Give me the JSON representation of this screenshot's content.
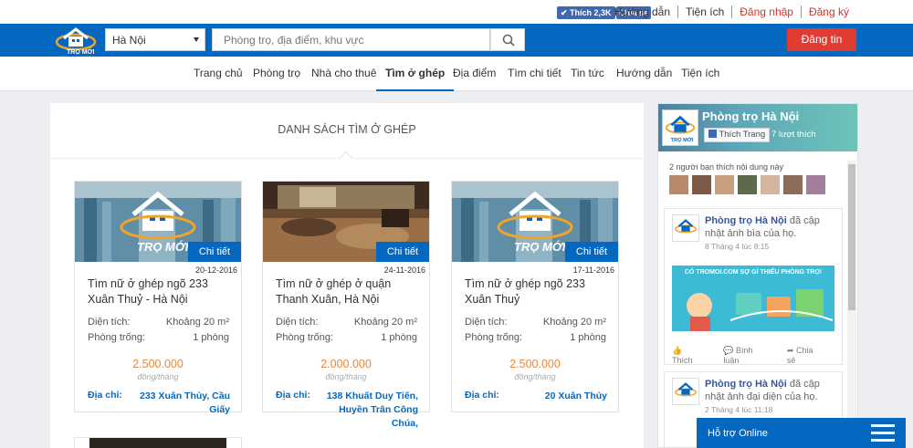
{
  "topbar": {
    "fb_like": "Thích 2,3K",
    "fb_share": "Chia sẻ",
    "links": [
      "Hướng dẫn",
      "Tiện ích",
      "Đăng nhập",
      "Đăng ký"
    ]
  },
  "header": {
    "logo_text": "TRỌ MỚI",
    "city": "Hà Nội",
    "search_placeholder": "Phòng trọ, địa điểm, khu vực",
    "post_button": "Đăng tin"
  },
  "nav": [
    "Trang chủ",
    "Phòng trọ",
    "Nhà cho thuê",
    "Tìm ở ghép",
    "Địa điểm",
    "Tìm chi tiết",
    "Tin tức",
    "Hướng dẫn",
    "Tiện ích"
  ],
  "main": {
    "title": "DANH SÁCH TÌM Ở GHÉP",
    "labels": {
      "detail": "Chi tiết",
      "area": "Diện tích:",
      "empty_rooms": "Phòng trống:",
      "unit": "đồng/tháng",
      "address": "Địa chỉ:"
    },
    "listings": [
      {
        "date": "20-12-2016",
        "title": "Tìm nữ ở ghép ngõ 233 Xuân Thuỷ - Hà Nội",
        "area": "Khoảng 20 m²",
        "rooms": "1 phòng",
        "price": "2.500.000",
        "address": "233 Xuân Thủy, Cầu Giấy"
      },
      {
        "date": "24-11-2016",
        "title": "Tìm nữ ở ghép ở quận Thanh Xuân, Hà Nội",
        "area": "Khoảng 20 m²",
        "rooms": "1 phòng",
        "price": "2.000.000",
        "address": "138 Khuất Duy Tiến, Huyền Trân Công Chúa,"
      },
      {
        "date": "17-11-2016",
        "title": "Tìm nữ ở ghép ngõ 233 Xuân Thuỷ",
        "area": "Khoảng 20 m²",
        "rooms": "1 phòng",
        "price": "2.500.000",
        "address": "20 Xuân Thủy"
      }
    ]
  },
  "sidebar": {
    "page_name": "Phòng trọ Hà Nội",
    "like_page": "Thích Trang",
    "likes": "7 lượt thích",
    "friends_text": "2 người bạn thích nội dung này",
    "posts": [
      {
        "author": "Phòng trọ Hà Nội",
        "action": " đã cập nhật ảnh bìa của họ.",
        "time": "8 Tháng 4 lúc 8:15",
        "banner_text": "CÓ TROMOI.COM SỢ GÌ THIẾU PHÒNG TRỌ!"
      },
      {
        "author": "Phòng trọ Hà Nội",
        "action": " đã cập nhật ảnh đại diện của họ.",
        "time": "2 Tháng 4 lúc 11:18"
      }
    ],
    "post_actions": [
      "Thích",
      "Bình luận",
      "Chia sẻ"
    ]
  },
  "support": {
    "label": "Hỗ trợ Online"
  }
}
